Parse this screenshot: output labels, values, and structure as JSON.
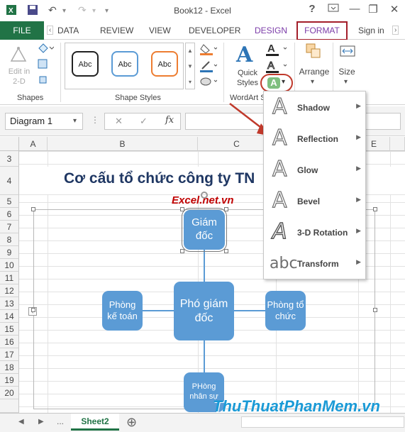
{
  "app": {
    "title": "Book12 - Excel",
    "help": "?",
    "minimize": "—",
    "restore": "❐",
    "close": "✕"
  },
  "tabs": {
    "file": "FILE",
    "items": [
      "DATA",
      "REVIEW",
      "VIEW",
      "DEVELOPER",
      "DESIGN"
    ],
    "active": "FORMAT",
    "signin": "Sign in"
  },
  "ribbon": {
    "shapes_group": "Shapes",
    "edit_2d": "Edit in 2-D",
    "styles_group": "Shape Styles",
    "abc": "Abc",
    "wordart_group": "WordArt S",
    "quick_styles": "Quick Styles",
    "arrange": "Arrange",
    "size": "Size"
  },
  "formula_bar": {
    "name_box": "Diagram 1",
    "fx": "fx",
    "cancel": "✕",
    "enter": "✓"
  },
  "columns": [
    "A",
    "B",
    "C",
    "E"
  ],
  "rows": [
    "3",
    "4",
    "5",
    "6",
    "7",
    "8",
    "9",
    "10",
    "11",
    "12",
    "13",
    "14",
    "15",
    "16",
    "17",
    "18",
    "19",
    "20"
  ],
  "sheet": {
    "title": "Cơ cấu tổ chức công ty TN",
    "site": "Excel.net.vn"
  },
  "diagram": {
    "top": "Giám đốc",
    "center": "Phó giám đốc",
    "left": "Phòng kế toán",
    "right": "Phòng tổ chức",
    "bottom": "PHòng nhân sự"
  },
  "effects_menu": [
    {
      "label": "Shadow",
      "glyph": "A"
    },
    {
      "label": "Reflection",
      "glyph": "A"
    },
    {
      "label": "Glow",
      "glyph": "A"
    },
    {
      "label": "Bevel",
      "glyph": "A"
    },
    {
      "label": "3-D Rotation",
      "glyph": "A"
    },
    {
      "label": "Transform",
      "glyph": "abc"
    }
  ],
  "status": {
    "sheet_tab": "Sheet2",
    "ellipsis": "...",
    "add": "⊕"
  },
  "watermark": "ThuThuatPhanMem.vn",
  "colors": {
    "excel_green": "#217346",
    "node_blue": "#5b9bd5",
    "highlight_red": "#a31e2a",
    "title_navy": "#1f3763"
  }
}
